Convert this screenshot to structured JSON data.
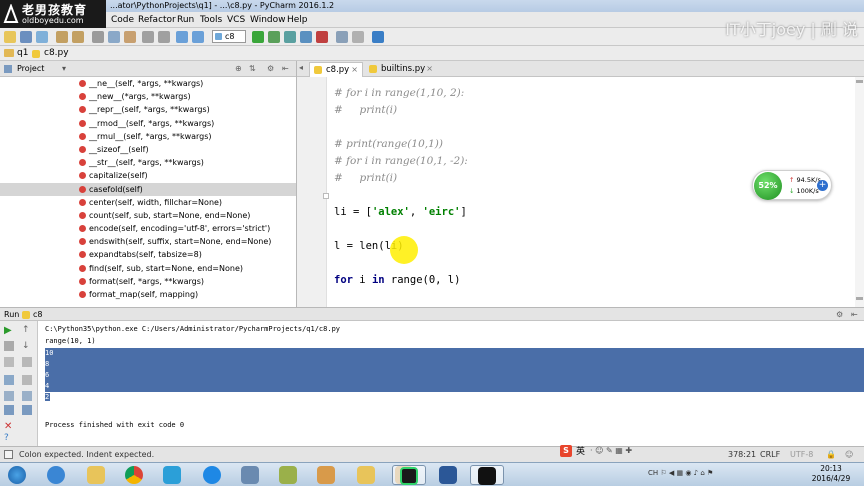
{
  "window": {
    "title": "...ator\\PythonProjects\\q1] - ...\\c8.py - PyCharm 2016.1.2"
  },
  "watermark": {
    "logo_main": "老男孩教育",
    "logo_sub": "oldboyedu.com",
    "right_text": "IT小丁joey | 刷 说"
  },
  "menu": [
    "Code",
    "Refactor",
    "Run",
    "Tools",
    "VCS",
    "Window",
    "Help"
  ],
  "toolbar": {
    "run_config": "c8"
  },
  "breadcrumb": {
    "project": "q1",
    "file": "c8.py"
  },
  "project_panel": {
    "title": "Project",
    "members": [
      "__ne__(self, *args, **kwargs)",
      "__new__(*args, **kwargs)",
      "__repr__(self, *args, **kwargs)",
      "__rmod__(self, *args, **kwargs)",
      "__rmul__(self, *args, **kwargs)",
      "__sizeof__(self)",
      "__str__(self, *args, **kwargs)",
      "capitalize(self)",
      "casefold(self)",
      "center(self, width, fillchar=None)",
      "count(self, sub, start=None, end=None)",
      "encode(self, encoding='utf-8', errors='strict')",
      "endswith(self, suffix, start=None, end=None)",
      "expandtabs(self, tabsize=8)",
      "find(self, sub, start=None, end=None)",
      "format(self, *args, **kwargs)",
      "format_map(self, mapping)"
    ],
    "selected_index": 8
  },
  "editor": {
    "tabs": [
      {
        "label": "c8.py",
        "active": true
      },
      {
        "label": "builtins.py",
        "active": false
      }
    ],
    "code": {
      "c1": "# for i in range(1,10, 2):",
      "c2": "#     print(i)",
      "c3": "# print(range(10,1))",
      "c4": "# for i in range(10,1, -2):",
      "c5": "#     print(i)",
      "li_lhs": "li = [",
      "li_s1": "'alex'",
      "li_comma": ", ",
      "li_s2": "'eirc'",
      "li_end": "]",
      "len_line": "l = len(li)",
      "for_kw": "for",
      "for_var": " i ",
      "in_kw": "in",
      "for_rest": " range(0, l)"
    }
  },
  "net_widget": {
    "percent": "52%",
    "up": "94.5K/s",
    "down": "100K/s"
  },
  "run_panel": {
    "title": "Run",
    "config": "c8",
    "command": "C:\\Python35\\python.exe C:/Users/Administrator/PycharmProjects/q1/c8.py",
    "output_range": "range(10, 1)",
    "output_values": [
      "10",
      "8",
      "6",
      "4",
      "2"
    ],
    "finish": "Process finished with exit code 0"
  },
  "status": {
    "message": "Colon expected. Indent expected.",
    "position": "378:21",
    "line_sep": "CRLF",
    "encoding": "UTF-8"
  },
  "clock": {
    "time": "20:13",
    "date": "2016/4/29"
  },
  "colors": {
    "selection": "#4a6ea8",
    "keyword": "#000080",
    "string": "#008000",
    "comment": "#8c8c8c"
  }
}
